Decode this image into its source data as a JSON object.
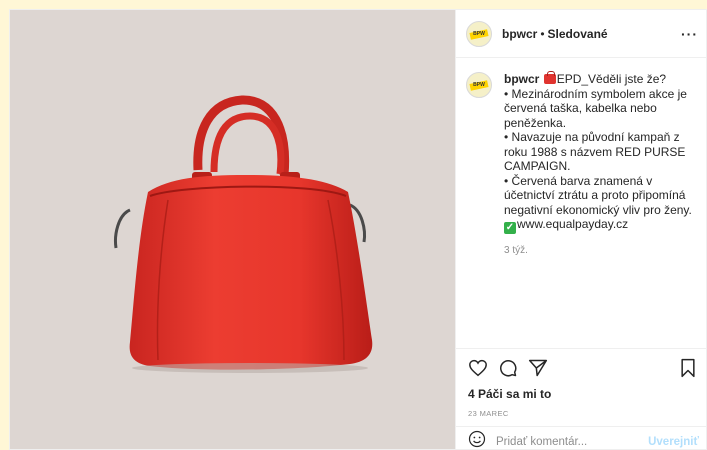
{
  "colors": {
    "page_bg": "#fff7d6",
    "photo_bg": "#ddd6d2",
    "bag_red": "#e8382f",
    "accent_blue": "#b2dffc",
    "muted": "#8e8e8e"
  },
  "post": {
    "author": "bpwcr",
    "dot": "•",
    "follow_status": "Sledované",
    "more_icon": "more-horizontal-icon",
    "caption": {
      "first_line_text": "EPD_Věděli jste že?",
      "lines": [
        "• Mezinárodním symbolem akce je červená taška, kabelka nebo peněženka.",
        "• Navazuje na původní kampaň z roku 1988 s názvem RED PURSE CAMPAIGN.",
        "• Červená barva znamená v účetnictví ztrátu a proto připomíná negativní ekonomický vliv pro ženy."
      ],
      "link_text": "www.equalpayday.cz"
    },
    "time_ago": "3 týž.",
    "likes": "4 Páči sa mi to",
    "date": "23 MAREC"
  },
  "comment": {
    "placeholder": "Pridať komentár...",
    "post_label": "Uverejniť"
  },
  "icons": {
    "like": "heart-icon",
    "comment": "comment-icon",
    "share": "send-icon",
    "save": "bookmark-icon",
    "emoji": "smiley-icon"
  }
}
